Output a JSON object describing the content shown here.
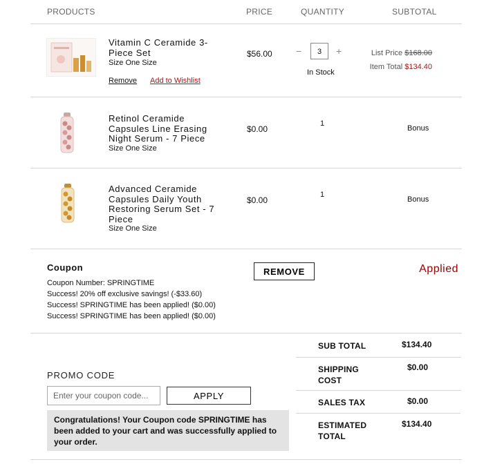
{
  "colors": {
    "sale_red": "#b01414",
    "applied_red": "#a00000",
    "border": "#d6d6d6",
    "message_bg": "#e3e3e3"
  },
  "headers": {
    "products": "PRODUCTS",
    "price": "PRICE",
    "quantity": "QUANTITY",
    "subtotal": "SUBTOTAL"
  },
  "items": [
    {
      "name": "Vitamin C Ceramide 3-Piece Set",
      "size": "Size One Size",
      "price": "$56.00",
      "quantity": "3",
      "stock": "In Stock",
      "remove_label": "Remove",
      "wishlist_label": "Add to Wishlist",
      "list_price_label": "List Price",
      "list_price": "$168.00",
      "item_total_label": "Item Total",
      "item_total": "$134.40",
      "minus": "−",
      "plus": "+",
      "image": "vitamin-c-set-product-image"
    },
    {
      "name": "Retinol Ceramide Capsules Line Erasing Night Serum - 7 Piece",
      "size": "Size One Size",
      "price": "$0.00",
      "quantity": "1",
      "subtotal": "Bonus",
      "image": "retinol-capsules-product-image"
    },
    {
      "name": "Advanced Ceramide Capsules Daily Youth Restoring Serum Set - 7 Piece",
      "size": "Size One Size",
      "price": "$0.00",
      "quantity": "1",
      "subtotal": "Bonus",
      "image": "advanced-capsules-product-image"
    }
  ],
  "coupon": {
    "title": "Coupon",
    "remove_label": "REMOVE",
    "status": "Applied",
    "lines": [
      "Coupon Number: SPRINGTIME",
      "Success! 20% off exclusive savings! (-$33.60)",
      "Success! SPRINGTIME has been applied! ($0.00)",
      "Success! SPRINGTIME has been applied! ($0.00)"
    ]
  },
  "promo": {
    "title": "PROMO CODE",
    "placeholder": "Enter your coupon code...",
    "apply_label": "APPLY",
    "message": "Congratulations! Your Coupon code SPRINGTIME has been added to your cart and was successfully applied to your order."
  },
  "totals": {
    "sub_total_label": "SUB TOTAL",
    "sub_total": "$134.40",
    "shipping_label": "SHIPPING COST",
    "shipping": "$0.00",
    "tax_label": "SALES TAX",
    "tax": "$0.00",
    "estimated_label": "ESTIMATED TOTAL",
    "estimated": "$134.40"
  }
}
